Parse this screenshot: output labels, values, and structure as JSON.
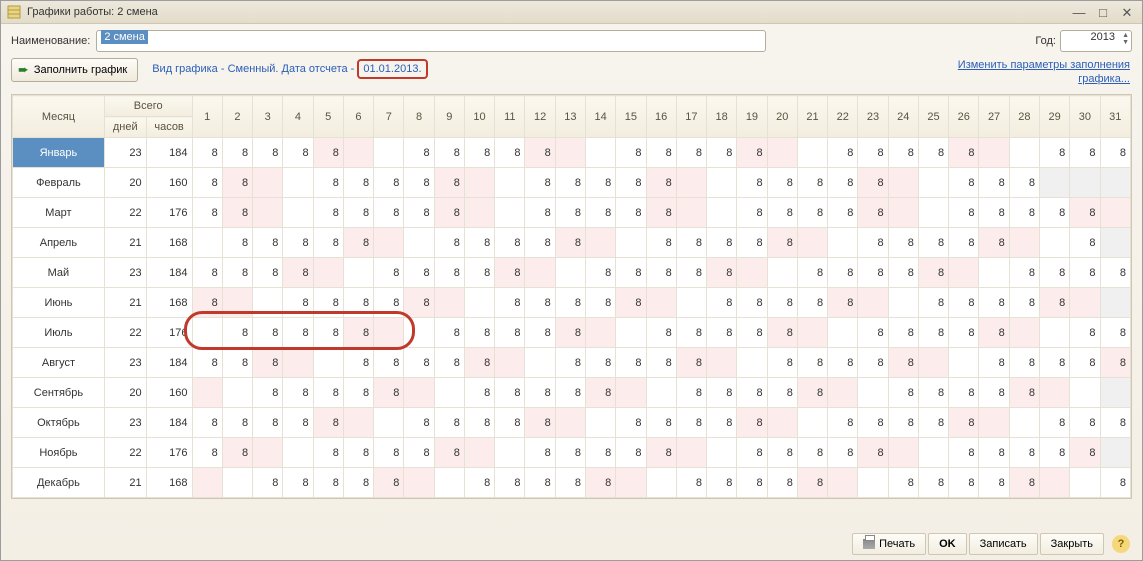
{
  "window_title": "Графики работы: 2 смена",
  "labels": {
    "name": "Наименование:",
    "year": "Год:",
    "fill": "Заполнить график",
    "month_hdr": "Месяц",
    "total_hdr": "Всего",
    "days_hdr": "дней",
    "hours_hdr": "часов"
  },
  "name_value": "2 смена",
  "year_value": "2013",
  "info_prefix": "Вид графика - Сменный. Дата отсчета -",
  "info_date": "01.01.2013.",
  "param_link_l1": "Изменить параметры заполнения",
  "param_link_l2": "графика...",
  "day_headers": [
    "1",
    "2",
    "3",
    "4",
    "5",
    "6",
    "7",
    "8",
    "9",
    "10",
    "11",
    "12",
    "13",
    "14",
    "15",
    "16",
    "17",
    "18",
    "19",
    "20",
    "21",
    "22",
    "23",
    "24",
    "25",
    "26",
    "27",
    "28",
    "29",
    "30",
    "31"
  ],
  "months": [
    {
      "name": "Январь",
      "days": 23,
      "hours": 184,
      "cells": [
        {
          "v": "8"
        },
        {
          "v": "8"
        },
        {
          "v": "8"
        },
        {
          "v": "8"
        },
        {
          "v": "8",
          "p": 1
        },
        {
          "v": "",
          "p": 1
        },
        {
          "v": ""
        },
        {
          "v": "8"
        },
        {
          "v": "8"
        },
        {
          "v": "8"
        },
        {
          "v": "8"
        },
        {
          "v": "8",
          "p": 1
        },
        {
          "v": "",
          "p": 1
        },
        {
          "v": ""
        },
        {
          "v": "8"
        },
        {
          "v": "8"
        },
        {
          "v": "8"
        },
        {
          "v": "8"
        },
        {
          "v": "8",
          "p": 1
        },
        {
          "v": "",
          "p": 1
        },
        {
          "v": ""
        },
        {
          "v": "8"
        },
        {
          "v": "8"
        },
        {
          "v": "8"
        },
        {
          "v": "8"
        },
        {
          "v": "8",
          "p": 1
        },
        {
          "v": "",
          "p": 1
        },
        {
          "v": ""
        },
        {
          "v": "8"
        },
        {
          "v": "8"
        },
        {
          "v": "8"
        }
      ]
    },
    {
      "name": "Февраль",
      "days": 20,
      "hours": 160,
      "cells": [
        {
          "v": "8"
        },
        {
          "v": "8",
          "p": 1
        },
        {
          "v": "",
          "p": 1
        },
        {
          "v": ""
        },
        {
          "v": "8"
        },
        {
          "v": "8"
        },
        {
          "v": "8"
        },
        {
          "v": "8"
        },
        {
          "v": "8",
          "p": 1
        },
        {
          "v": "",
          "p": 1
        },
        {
          "v": ""
        },
        {
          "v": "8"
        },
        {
          "v": "8"
        },
        {
          "v": "8"
        },
        {
          "v": "8"
        },
        {
          "v": "8",
          "p": 1
        },
        {
          "v": "",
          "p": 1
        },
        {
          "v": ""
        },
        {
          "v": "8"
        },
        {
          "v": "8"
        },
        {
          "v": "8"
        },
        {
          "v": "8"
        },
        {
          "v": "8",
          "p": 1
        },
        {
          "v": "",
          "p": 1
        },
        {
          "v": ""
        },
        {
          "v": "8"
        },
        {
          "v": "8"
        },
        {
          "v": "8"
        },
        {
          "v": "",
          "g": 1
        },
        {
          "v": "",
          "g": 1
        },
        {
          "v": "",
          "g": 1
        }
      ]
    },
    {
      "name": "Март",
      "days": 22,
      "hours": 176,
      "cells": [
        {
          "v": "8"
        },
        {
          "v": "8",
          "p": 1
        },
        {
          "v": "",
          "p": 1
        },
        {
          "v": ""
        },
        {
          "v": "8"
        },
        {
          "v": "8"
        },
        {
          "v": "8"
        },
        {
          "v": "8"
        },
        {
          "v": "8",
          "p": 1
        },
        {
          "v": "",
          "p": 1
        },
        {
          "v": ""
        },
        {
          "v": "8"
        },
        {
          "v": "8"
        },
        {
          "v": "8"
        },
        {
          "v": "8"
        },
        {
          "v": "8",
          "p": 1
        },
        {
          "v": "",
          "p": 1
        },
        {
          "v": ""
        },
        {
          "v": "8"
        },
        {
          "v": "8"
        },
        {
          "v": "8"
        },
        {
          "v": "8"
        },
        {
          "v": "8",
          "p": 1
        },
        {
          "v": "",
          "p": 1
        },
        {
          "v": ""
        },
        {
          "v": "8"
        },
        {
          "v": "8"
        },
        {
          "v": "8"
        },
        {
          "v": "8"
        },
        {
          "v": "8",
          "p": 1
        },
        {
          "v": "",
          "p": 1
        }
      ]
    },
    {
      "name": "Апрель",
      "days": 21,
      "hours": 168,
      "cells": [
        {
          "v": ""
        },
        {
          "v": "8"
        },
        {
          "v": "8"
        },
        {
          "v": "8"
        },
        {
          "v": "8"
        },
        {
          "v": "8",
          "p": 1
        },
        {
          "v": "",
          "p": 1
        },
        {
          "v": ""
        },
        {
          "v": "8"
        },
        {
          "v": "8"
        },
        {
          "v": "8"
        },
        {
          "v": "8"
        },
        {
          "v": "8",
          "p": 1
        },
        {
          "v": "",
          "p": 1
        },
        {
          "v": ""
        },
        {
          "v": "8"
        },
        {
          "v": "8"
        },
        {
          "v": "8"
        },
        {
          "v": "8"
        },
        {
          "v": "8",
          "p": 1
        },
        {
          "v": "",
          "p": 1
        },
        {
          "v": ""
        },
        {
          "v": "8"
        },
        {
          "v": "8"
        },
        {
          "v": "8"
        },
        {
          "v": "8"
        },
        {
          "v": "8",
          "p": 1
        },
        {
          "v": "",
          "p": 1
        },
        {
          "v": ""
        },
        {
          "v": "8"
        },
        {
          "v": "",
          "g": 1
        }
      ]
    },
    {
      "name": "Май",
      "days": 23,
      "hours": 184,
      "cells": [
        {
          "v": "8"
        },
        {
          "v": "8"
        },
        {
          "v": "8"
        },
        {
          "v": "8",
          "p": 1
        },
        {
          "v": "",
          "p": 1
        },
        {
          "v": ""
        },
        {
          "v": "8"
        },
        {
          "v": "8"
        },
        {
          "v": "8"
        },
        {
          "v": "8"
        },
        {
          "v": "8",
          "p": 1
        },
        {
          "v": "",
          "p": 1
        },
        {
          "v": ""
        },
        {
          "v": "8"
        },
        {
          "v": "8"
        },
        {
          "v": "8"
        },
        {
          "v": "8"
        },
        {
          "v": "8",
          "p": 1
        },
        {
          "v": "",
          "p": 1
        },
        {
          "v": ""
        },
        {
          "v": "8"
        },
        {
          "v": "8"
        },
        {
          "v": "8"
        },
        {
          "v": "8"
        },
        {
          "v": "8",
          "p": 1
        },
        {
          "v": "",
          "p": 1
        },
        {
          "v": ""
        },
        {
          "v": "8"
        },
        {
          "v": "8"
        },
        {
          "v": "8"
        },
        {
          "v": "8"
        }
      ]
    },
    {
      "name": "Июнь",
      "days": 21,
      "hours": 168,
      "cells": [
        {
          "v": "8",
          "p": 1
        },
        {
          "v": "",
          "p": 1
        },
        {
          "v": ""
        },
        {
          "v": "8"
        },
        {
          "v": "8"
        },
        {
          "v": "8"
        },
        {
          "v": "8"
        },
        {
          "v": "8",
          "p": 1
        },
        {
          "v": "",
          "p": 1
        },
        {
          "v": ""
        },
        {
          "v": "8"
        },
        {
          "v": "8"
        },
        {
          "v": "8"
        },
        {
          "v": "8"
        },
        {
          "v": "8",
          "p": 1
        },
        {
          "v": "",
          "p": 1
        },
        {
          "v": ""
        },
        {
          "v": "8"
        },
        {
          "v": "8"
        },
        {
          "v": "8"
        },
        {
          "v": "8"
        },
        {
          "v": "8",
          "p": 1
        },
        {
          "v": "",
          "p": 1
        },
        {
          "v": ""
        },
        {
          "v": "8"
        },
        {
          "v": "8"
        },
        {
          "v": "8"
        },
        {
          "v": "8"
        },
        {
          "v": "8",
          "p": 1
        },
        {
          "v": "",
          "p": 1
        },
        {
          "v": "",
          "g": 1
        }
      ]
    },
    {
      "name": "Июль",
      "days": 22,
      "hours": 176,
      "cells": [
        {
          "v": ""
        },
        {
          "v": "8"
        },
        {
          "v": "8"
        },
        {
          "v": "8"
        },
        {
          "v": "8"
        },
        {
          "v": "8",
          "p": 1
        },
        {
          "v": "",
          "p": 1
        },
        {
          "v": ""
        },
        {
          "v": "8"
        },
        {
          "v": "8"
        },
        {
          "v": "8"
        },
        {
          "v": "8"
        },
        {
          "v": "8",
          "p": 1
        },
        {
          "v": "",
          "p": 1
        },
        {
          "v": ""
        },
        {
          "v": "8"
        },
        {
          "v": "8"
        },
        {
          "v": "8"
        },
        {
          "v": "8"
        },
        {
          "v": "8",
          "p": 1
        },
        {
          "v": "",
          "p": 1
        },
        {
          "v": ""
        },
        {
          "v": "8"
        },
        {
          "v": "8"
        },
        {
          "v": "8"
        },
        {
          "v": "8"
        },
        {
          "v": "8",
          "p": 1
        },
        {
          "v": "",
          "p": 1
        },
        {
          "v": ""
        },
        {
          "v": "8"
        },
        {
          "v": "8"
        }
      ]
    },
    {
      "name": "Август",
      "days": 23,
      "hours": 184,
      "cells": [
        {
          "v": "8"
        },
        {
          "v": "8"
        },
        {
          "v": "8",
          "p": 1
        },
        {
          "v": "",
          "p": 1
        },
        {
          "v": ""
        },
        {
          "v": "8"
        },
        {
          "v": "8"
        },
        {
          "v": "8"
        },
        {
          "v": "8"
        },
        {
          "v": "8",
          "p": 1
        },
        {
          "v": "",
          "p": 1
        },
        {
          "v": ""
        },
        {
          "v": "8"
        },
        {
          "v": "8"
        },
        {
          "v": "8"
        },
        {
          "v": "8"
        },
        {
          "v": "8",
          "p": 1
        },
        {
          "v": "",
          "p": 1
        },
        {
          "v": ""
        },
        {
          "v": "8"
        },
        {
          "v": "8"
        },
        {
          "v": "8"
        },
        {
          "v": "8"
        },
        {
          "v": "8",
          "p": 1
        },
        {
          "v": "",
          "p": 1
        },
        {
          "v": ""
        },
        {
          "v": "8"
        },
        {
          "v": "8"
        },
        {
          "v": "8"
        },
        {
          "v": "8"
        },
        {
          "v": "8",
          "p": 1
        }
      ]
    },
    {
      "name": "Сентябрь",
      "days": 20,
      "hours": 160,
      "cells": [
        {
          "v": "",
          "p": 1
        },
        {
          "v": ""
        },
        {
          "v": "8"
        },
        {
          "v": "8"
        },
        {
          "v": "8"
        },
        {
          "v": "8"
        },
        {
          "v": "8",
          "p": 1
        },
        {
          "v": "",
          "p": 1
        },
        {
          "v": ""
        },
        {
          "v": "8"
        },
        {
          "v": "8"
        },
        {
          "v": "8"
        },
        {
          "v": "8"
        },
        {
          "v": "8",
          "p": 1
        },
        {
          "v": "",
          "p": 1
        },
        {
          "v": ""
        },
        {
          "v": "8"
        },
        {
          "v": "8"
        },
        {
          "v": "8"
        },
        {
          "v": "8"
        },
        {
          "v": "8",
          "p": 1
        },
        {
          "v": "",
          "p": 1
        },
        {
          "v": ""
        },
        {
          "v": "8"
        },
        {
          "v": "8"
        },
        {
          "v": "8"
        },
        {
          "v": "8"
        },
        {
          "v": "8",
          "p": 1
        },
        {
          "v": "",
          "p": 1
        },
        {
          "v": ""
        },
        {
          "v": "",
          "g": 1
        }
      ]
    },
    {
      "name": "Октябрь",
      "days": 23,
      "hours": 184,
      "cells": [
        {
          "v": "8"
        },
        {
          "v": "8"
        },
        {
          "v": "8"
        },
        {
          "v": "8"
        },
        {
          "v": "8",
          "p": 1
        },
        {
          "v": "",
          "p": 1
        },
        {
          "v": ""
        },
        {
          "v": "8"
        },
        {
          "v": "8"
        },
        {
          "v": "8"
        },
        {
          "v": "8"
        },
        {
          "v": "8",
          "p": 1
        },
        {
          "v": "",
          "p": 1
        },
        {
          "v": ""
        },
        {
          "v": "8"
        },
        {
          "v": "8"
        },
        {
          "v": "8"
        },
        {
          "v": "8"
        },
        {
          "v": "8",
          "p": 1
        },
        {
          "v": "",
          "p": 1
        },
        {
          "v": ""
        },
        {
          "v": "8"
        },
        {
          "v": "8"
        },
        {
          "v": "8"
        },
        {
          "v": "8"
        },
        {
          "v": "8",
          "p": 1
        },
        {
          "v": "",
          "p": 1
        },
        {
          "v": ""
        },
        {
          "v": "8"
        },
        {
          "v": "8"
        },
        {
          "v": "8"
        }
      ]
    },
    {
      "name": "Ноябрь",
      "days": 22,
      "hours": 176,
      "cells": [
        {
          "v": "8"
        },
        {
          "v": "8",
          "p": 1
        },
        {
          "v": "",
          "p": 1
        },
        {
          "v": ""
        },
        {
          "v": "8"
        },
        {
          "v": "8"
        },
        {
          "v": "8"
        },
        {
          "v": "8"
        },
        {
          "v": "8",
          "p": 1
        },
        {
          "v": "",
          "p": 1
        },
        {
          "v": ""
        },
        {
          "v": "8"
        },
        {
          "v": "8"
        },
        {
          "v": "8"
        },
        {
          "v": "8"
        },
        {
          "v": "8",
          "p": 1
        },
        {
          "v": "",
          "p": 1
        },
        {
          "v": ""
        },
        {
          "v": "8"
        },
        {
          "v": "8"
        },
        {
          "v": "8"
        },
        {
          "v": "8"
        },
        {
          "v": "8",
          "p": 1
        },
        {
          "v": "",
          "p": 1
        },
        {
          "v": ""
        },
        {
          "v": "8"
        },
        {
          "v": "8"
        },
        {
          "v": "8"
        },
        {
          "v": "8"
        },
        {
          "v": "8",
          "p": 1
        },
        {
          "v": "",
          "g": 1
        }
      ]
    },
    {
      "name": "Декабрь",
      "days": 21,
      "hours": 168,
      "cells": [
        {
          "v": "",
          "p": 1
        },
        {
          "v": ""
        },
        {
          "v": "8"
        },
        {
          "v": "8"
        },
        {
          "v": "8"
        },
        {
          "v": "8"
        },
        {
          "v": "8",
          "p": 1
        },
        {
          "v": "",
          "p": 1
        },
        {
          "v": ""
        },
        {
          "v": "8"
        },
        {
          "v": "8"
        },
        {
          "v": "8"
        },
        {
          "v": "8"
        },
        {
          "v": "8",
          "p": 1
        },
        {
          "v": "",
          "p": 1
        },
        {
          "v": ""
        },
        {
          "v": "8"
        },
        {
          "v": "8"
        },
        {
          "v": "8"
        },
        {
          "v": "8"
        },
        {
          "v": "8",
          "p": 1
        },
        {
          "v": "",
          "p": 1
        },
        {
          "v": ""
        },
        {
          "v": "8"
        },
        {
          "v": "8"
        },
        {
          "v": "8"
        },
        {
          "v": "8"
        },
        {
          "v": "8",
          "p": 1
        },
        {
          "v": "",
          "p": 1
        },
        {
          "v": ""
        },
        {
          "v": "8"
        }
      ]
    }
  ],
  "footer": {
    "print": "Печать",
    "ok": "OK",
    "save": "Записать",
    "close": "Закрыть"
  }
}
